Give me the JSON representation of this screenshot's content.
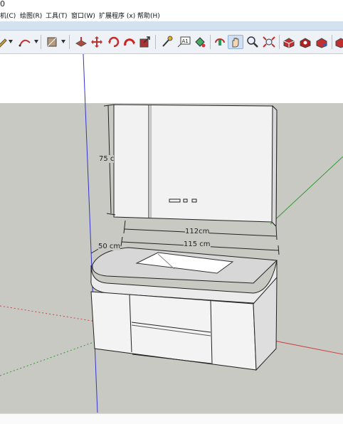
{
  "title_fragment": "0",
  "menus": [
    {
      "label": "机(C)"
    },
    {
      "label": "绘图(R)"
    },
    {
      "label": "工具(T)"
    },
    {
      "label": "窗口(W)"
    },
    {
      "label": "扩展程序 (x)"
    },
    {
      "label": "帮助(H)"
    }
  ],
  "toolbar": {
    "icons": [
      "pencil-icon",
      "arc-icon",
      "rectangle-icon",
      "push-pull-icon",
      "move-icon",
      "rotate-icon",
      "scale-icon",
      "tape-measure-icon",
      "text-icon",
      "paint-bucket-icon",
      "orbit-icon",
      "pan-icon",
      "zoom-icon",
      "zoom-extents-icon",
      "components-icon",
      "warehouse-icon",
      "extension-icon"
    ],
    "text_tool_label": "A1",
    "active_tool": "pan-icon"
  },
  "dimensions": {
    "height_label": "75 c",
    "mirror_width_label": "112cm",
    "vanity_width_label": "115 cm",
    "depth_label": "50 cm"
  },
  "colors": {
    "ground": "#c9c9c4",
    "sky": "#ffffff",
    "blue_axis": "#3333cc",
    "green_axis": "#339933",
    "red_axis": "#cc4444",
    "active_tool_bg": "#cfe0f5"
  }
}
